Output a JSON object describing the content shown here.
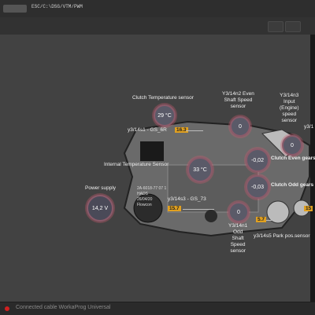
{
  "header": {
    "path": "ESC/C:\\DSG/VTM/PWM"
  },
  "statusbar": {
    "text": "Connected cable WorkaProg Universal"
  },
  "sensors": {
    "clutch_temp": {
      "label": "Clutch Temperature sensor",
      "value": "29 °C",
      "id": "y3/14s1 - GS_6R",
      "badge": "16.3"
    },
    "internal_temp": {
      "label": "Internal Temperature Sensor",
      "value": "33 °C"
    },
    "power": {
      "label": "Power supply",
      "value": "14,2 V"
    },
    "even_speed": {
      "label": "Y3/14n2 Even\nShaft Speed\nsensor",
      "value": "0"
    },
    "input_speed": {
      "label": "Y3/14n3\nInput\n(Engine)\nspeed\nsensor",
      "value": "0"
    },
    "clutch_even": {
      "label": "Clutch Even gears",
      "value": "-0,02"
    },
    "clutch_odd": {
      "label": "Clutch Odd gears",
      "value": "-0,03"
    },
    "odd_speed": {
      "label": "Y3/14n1\nOdd\nShaft\nSpeed\nsensor",
      "value": "0"
    },
    "gs73": {
      "id": "y3/14s3 - GS_73",
      "badge": "15.7"
    },
    "park": {
      "label": "y3/14s5 Park pos.sensor",
      "badge": "5.7"
    },
    "right_cut": {
      "label": "y3/1",
      "badge": "15"
    }
  },
  "pcb_text": [
    "2A-6018-77 07 1",
    "HADS",
    "26/04/20",
    "Flowcon"
  ]
}
